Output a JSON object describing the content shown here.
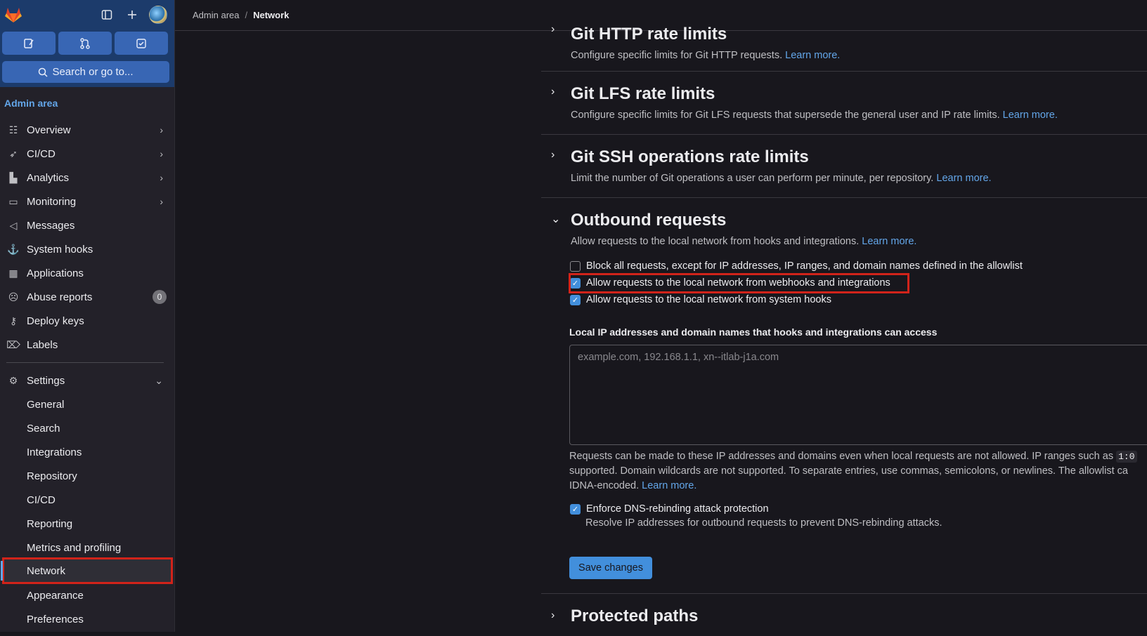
{
  "sidebar": {
    "search_label": "Search or go to...",
    "admin_label": "Admin area",
    "items": [
      {
        "label": "Overview",
        "icon": "list-icon",
        "chevron": true
      },
      {
        "label": "CI/CD",
        "icon": "rocket-icon",
        "chevron": true
      },
      {
        "label": "Analytics",
        "icon": "chart-icon",
        "chevron": true
      },
      {
        "label": "Monitoring",
        "icon": "monitor-icon",
        "chevron": true
      },
      {
        "label": "Messages",
        "icon": "megaphone-icon",
        "chevron": false
      },
      {
        "label": "System hooks",
        "icon": "anchor-icon",
        "chevron": false
      },
      {
        "label": "Applications",
        "icon": "apps-icon",
        "chevron": false
      },
      {
        "label": "Abuse reports",
        "icon": "sad-face-icon",
        "chevron": false,
        "badge": "0"
      },
      {
        "label": "Deploy keys",
        "icon": "key-icon",
        "chevron": false
      },
      {
        "label": "Labels",
        "icon": "label-icon",
        "chevron": false
      }
    ],
    "settings_label": "Settings",
    "settings_items": [
      "General",
      "Search",
      "Integrations",
      "Repository",
      "CI/CD",
      "Reporting",
      "Metrics and profiling",
      "Network",
      "Appearance",
      "Preferences"
    ]
  },
  "breadcrumb": {
    "parent": "Admin area",
    "current": "Network"
  },
  "sections": {
    "http": {
      "title": "Git HTTP rate limits",
      "desc": "Configure specific limits for Git HTTP requests.",
      "link": "Learn more."
    },
    "lfs": {
      "title": "Git LFS rate limits",
      "desc": "Configure specific limits for Git LFS requests that supersede the general user and IP rate limits.",
      "link": "Learn more."
    },
    "ssh": {
      "title": "Git SSH operations rate limits",
      "desc": "Limit the number of Git operations a user can perform per minute, per repository.",
      "link": "Learn more."
    },
    "outbound": {
      "title": "Outbound requests",
      "desc": "Allow requests to the local network from hooks and integrations.",
      "link": "Learn more.",
      "checkbox_block": "Block all requests, except for IP addresses, IP ranges, and domain names defined in the allowlist",
      "checkbox_webhooks": "Allow requests to the local network from webhooks and integrations",
      "checkbox_system": "Allow requests to the local network from system hooks",
      "field_label": "Local IP addresses and domain names that hooks and integrations can access",
      "placeholder": "example.com, 192.168.1.1, xn--itlab-j1a.com",
      "help_1": "Requests can be made to these IP addresses and domains even when local requests are not allowed. IP ranges such as",
      "help_code": "1:0",
      "help_2": "supported. Domain wildcards are not supported. To separate entries, use commas, semicolons, or newlines. The allowlist ca",
      "help_3": "IDNA-encoded.",
      "help_link": "Learn more.",
      "dns_label": "Enforce DNS-rebinding attack protection",
      "dns_desc": "Resolve IP addresses for outbound requests to prevent DNS-rebinding attacks.",
      "save": "Save changes"
    },
    "protected": {
      "title": "Protected paths"
    }
  },
  "colors": {
    "accent": "#428fdc",
    "highlight": "#d1231a",
    "sidebar_top": "#1c3b6b"
  }
}
